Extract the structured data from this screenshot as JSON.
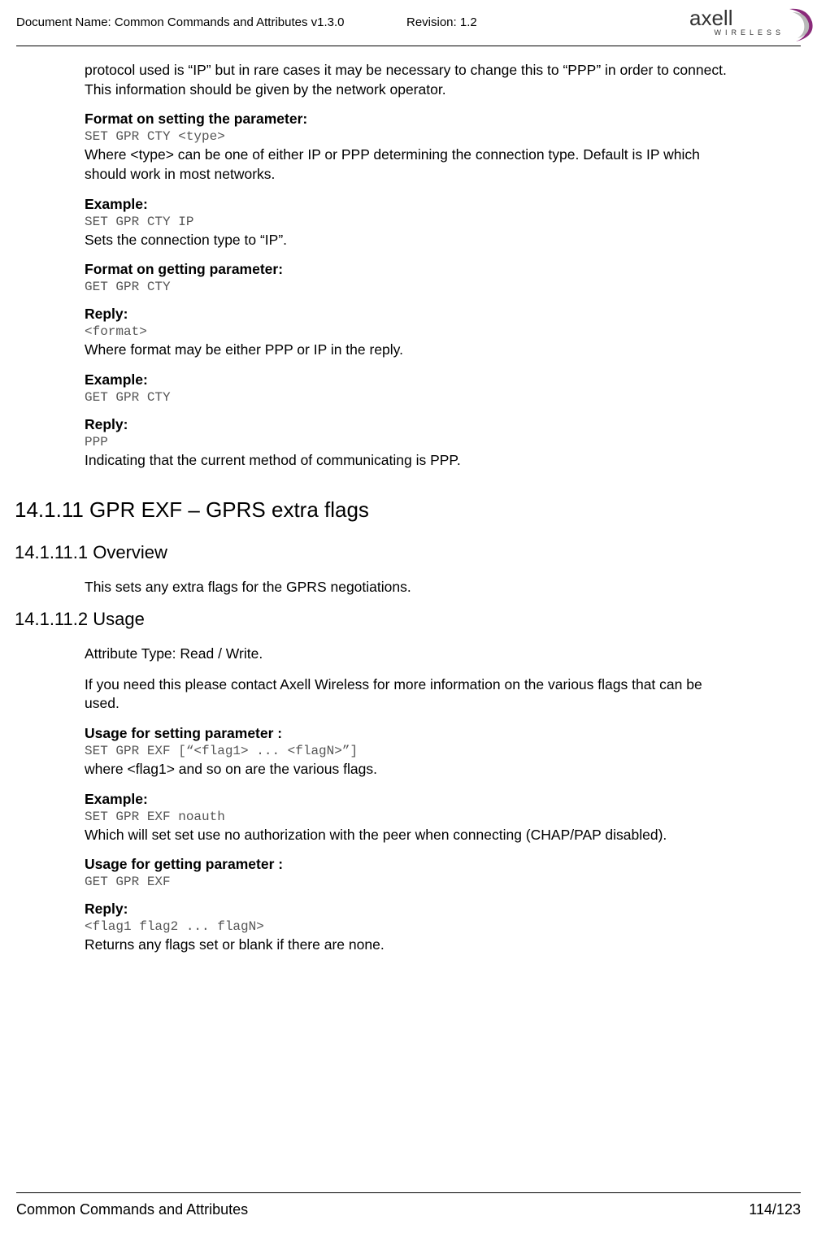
{
  "header": {
    "doc_name_label": "Document Name: Common Commands and Attributes v1.3.0",
    "revision_label": "Revision: 1.2",
    "logo_text": "axell",
    "logo_sub": "WIRELESS"
  },
  "body": {
    "intro_para": "protocol used is “IP” but in rare cases it may be necessary to change this to “PPP” in order to connect. This information should be given by the network operator.",
    "sec1": {
      "h1": "Format on setting the parameter:",
      "code1": "SET GPR CTY <type>",
      "p1": "Where <type> can be one of either IP or PPP determining the connection type. Default is IP which should work in most networks.",
      "h2": "Example:",
      "code2": "SET GPR CTY IP",
      "p2": "Sets the connection type to “IP”.",
      "h3": "Format on getting parameter:",
      "code3": "GET GPR CTY",
      "h4": "Reply:",
      "code4": "<format>",
      "p3": "Where format may be either PPP or IP in the reply.",
      "h5": "Example:",
      "code5": "GET GPR CTY",
      "h6": "Reply:",
      "code6": "PPP",
      "p4": "Indicating that the current method of communicating is PPP."
    },
    "heading2": "14.1.11 GPR EXF – GPRS extra flags",
    "heading3a": "14.1.11.1 Overview",
    "overview_p": "This sets any extra flags for the GPRS negotiations.",
    "heading3b": "14.1.11.2 Usage",
    "usage": {
      "p1": "Attribute Type: Read / Write.",
      "p2": "If you need this please contact Axell Wireless for more information on the various flags that can be used.",
      "h1": "Usage for setting parameter :",
      "code1": "SET GPR EXF [“<flag1> ... <flagN>”]",
      "p3": "where <flag1> and so on are the various flags.",
      "h2": "Example:",
      "code2": "SET GPR EXF noauth",
      "p4": "Which will set set use no authorization with the peer when connecting (CHAP/PAP disabled).",
      "h3": "Usage for getting parameter :",
      "code3": "GET GPR EXF",
      "h4": "Reply:",
      "code4": "<flag1 flag2 ... flagN>",
      "p5": "Returns any flags set or blank if there are none."
    }
  },
  "footer": {
    "title": "Common Commands and Attributes",
    "page": "114/123"
  }
}
